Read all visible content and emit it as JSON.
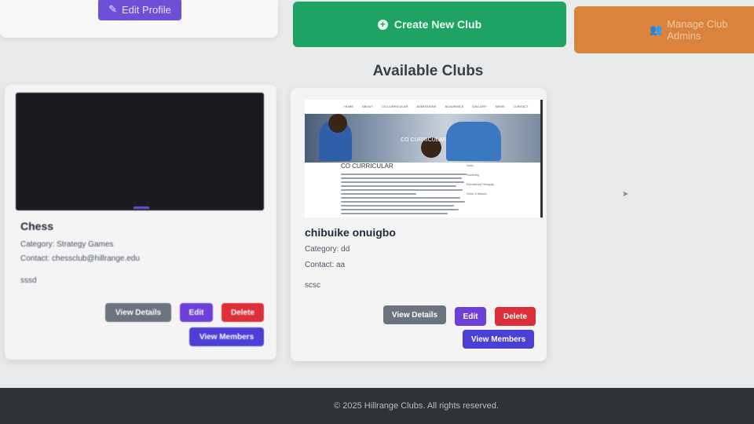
{
  "header": {
    "edit_profile_label": "Edit Profile",
    "create_club_label": "Create New Club",
    "manage_label": "Manage Club Admins"
  },
  "section_title": "Available Clubs",
  "clubs": [
    {
      "name": "Chess",
      "category": "Category: Strategy Games",
      "contact": "Contact: chessclub@hillrange.edu",
      "description": "sssd",
      "thumbnail": "dark-screenshot"
    },
    {
      "name": "chibuike onuigbo",
      "category": "Category: dd",
      "contact": "Contact: aa",
      "description": "scsc",
      "thumbnail": "co-curricular-page",
      "thumb_nav": [
        "HOME",
        "ABOUT",
        "CO-CURRICULAR",
        "ADMISSIONS",
        "ACADEMICS",
        "GALLERY",
        "NEWS",
        "CONTACT"
      ],
      "thumb_hero_title": "CO CURRICULAR",
      "thumb_heading": "CO CURRICULAR",
      "thumb_side": [
        "Clubs",
        "Swimming",
        "Educational Pedagogy",
        "Vision & Mission"
      ]
    }
  ],
  "buttons": {
    "view_details": "View Details",
    "edit": "Edit",
    "delete": "Delete",
    "view_members": "View Members"
  },
  "footer": {
    "copyright": "© 2025 Hillrange Clubs. All rights reserved."
  },
  "colors": {
    "create": "#1fa364",
    "manage": "#d8782a",
    "edit_profile": "#6d4fd8",
    "delete": "#dc2f3a",
    "members": "#4b3fd6"
  }
}
